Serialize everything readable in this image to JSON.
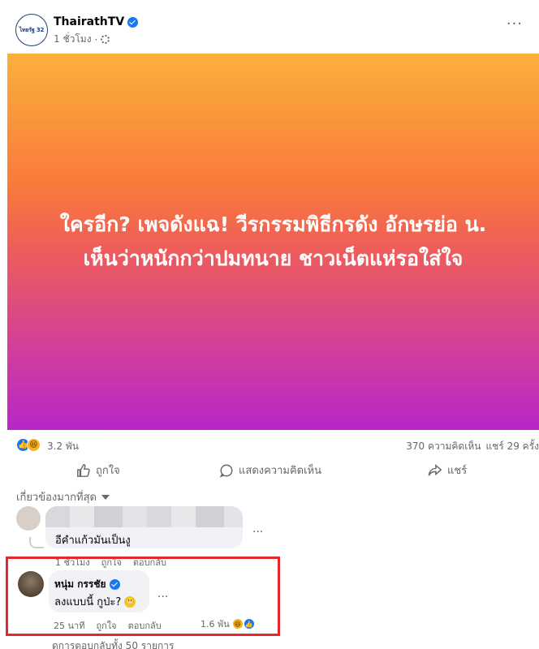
{
  "post": {
    "page_name": "ThairathTV",
    "page_logo_text": "ไทยรัฐ 32",
    "time": "1 ชั่วโมง",
    "separator": "·",
    "headline_line1": "ใครอีก? เพจดังแฉ! วีรกรรมพิธีกรดัง อักษรย่อ น.",
    "headline_line2": "เห็นว่าหนักกว่าปมทนาย ชาวเน็ตแห่รอใส่ใจ",
    "image_colors": [
      "#fbb03b",
      "#f97a3b",
      "#ee5d5a",
      "#d23f9a",
      "#b726c8"
    ]
  },
  "stats": {
    "reactions": "3.2 พัน",
    "comments": "370 ความคิดเห็น",
    "shares": "แชร์ 29 ครั้ง"
  },
  "actions": {
    "like": "ถูกใจ",
    "comment": "แสดงความคิดเห็น",
    "share": "แชร์"
  },
  "sort_label": "เกี่ยวข้องมากที่สุด",
  "comments": [
    {
      "text": "อีคำแก้วมันเป็นงู",
      "time": "1 ชั่วโมง",
      "like": "ถูกใจ",
      "reply": "ตอบกลับ"
    },
    {
      "name": "หนุ่ม กรรชัย",
      "text": "ลงแบบนี้ กูป่ะ?",
      "time": "25 นาที",
      "like": "ถูกใจ",
      "reply": "ตอบกลับ",
      "reactions": "1.6 พัน"
    }
  ],
  "view_replies": "ดูการตอบกลับทั้ง 50 รายการ",
  "highlight_color": "#e3282e"
}
